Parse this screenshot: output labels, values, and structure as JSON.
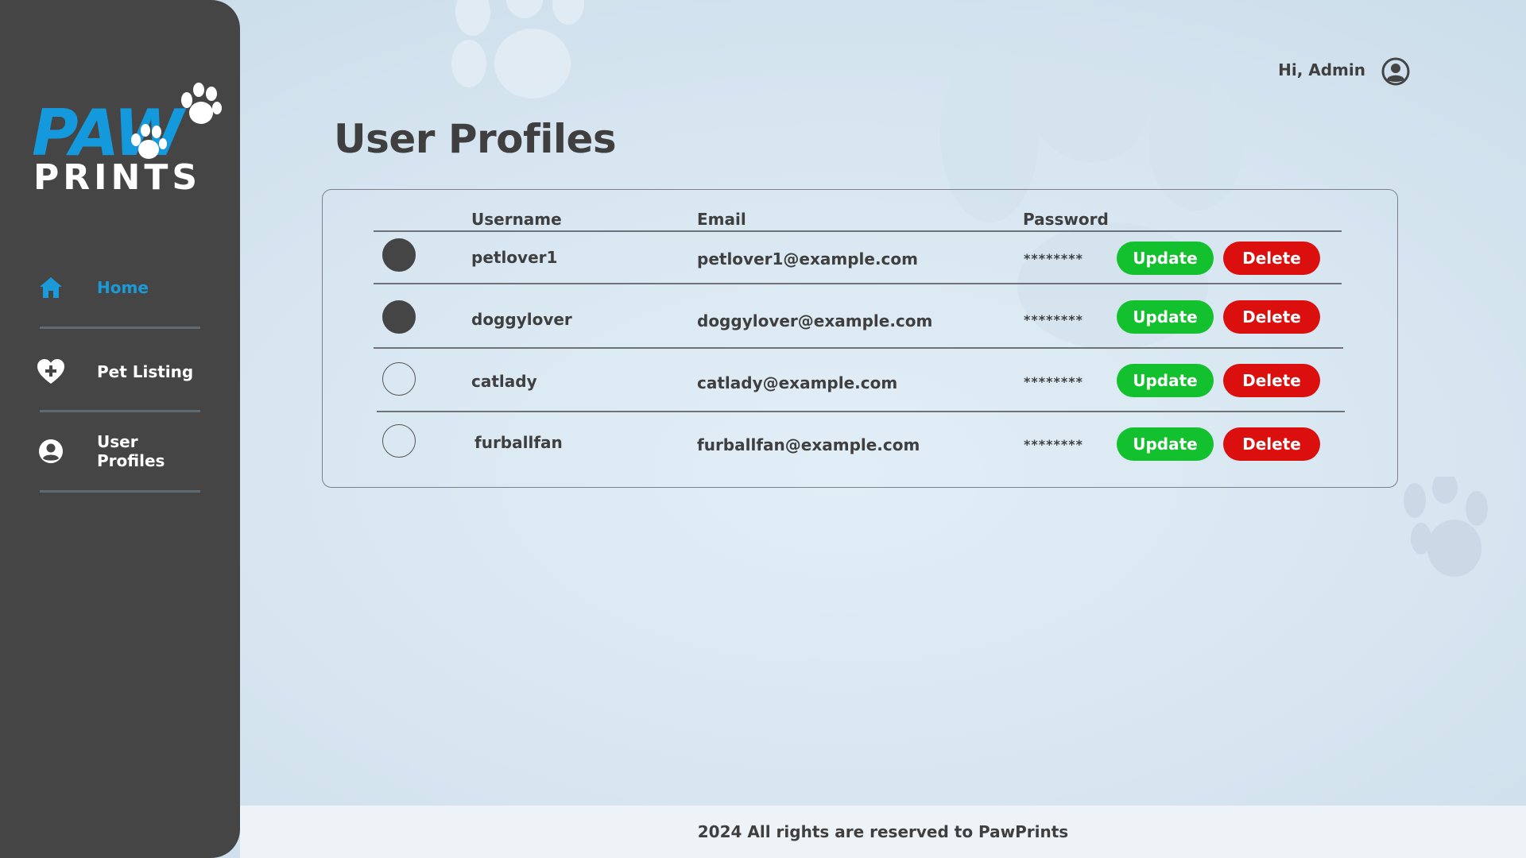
{
  "app": {
    "brand_top": "PAW",
    "brand_bottom": "PRINTS"
  },
  "sidebar": {
    "items": [
      {
        "label": "Home",
        "icon": "home-icon",
        "active": true
      },
      {
        "label": "Pet Listing",
        "icon": "heart-plus-icon",
        "active": false
      },
      {
        "label": "User Profiles",
        "icon": "user-circle-icon",
        "active": false
      }
    ]
  },
  "header": {
    "greeting": "Hi, Admin",
    "user_icon": "user-circle-icon"
  },
  "page": {
    "title": "User Profiles"
  },
  "table": {
    "columns": [
      "Username",
      "Email",
      "Password"
    ],
    "rows": [
      {
        "username": "petlover1",
        "email": "petlover1@example.com",
        "password": "********",
        "avatar": "filled",
        "update": "Update",
        "delete": "Delete"
      },
      {
        "username": "doggylover",
        "email": "doggylover@example.com",
        "password": "********",
        "avatar": "filled",
        "update": "Update",
        "delete": "Delete"
      },
      {
        "username": "catlady",
        "email": "catlady@example.com",
        "password": "********",
        "avatar": "empty",
        "update": "Update",
        "delete": "Delete"
      },
      {
        "username": "furballfan",
        "email": "furballfan@example.com",
        "password": "********",
        "avatar": "empty",
        "update": "Update",
        "delete": "Delete"
      }
    ]
  },
  "footer": {
    "text": "2024 All rights are reserved to PawPrints"
  },
  "colors": {
    "sidebar_bg": "#454545",
    "accent": "#1a9ad8",
    "update_btn": "#13c02e",
    "delete_btn": "#dc0f0f",
    "text": "#3f3f3f"
  }
}
